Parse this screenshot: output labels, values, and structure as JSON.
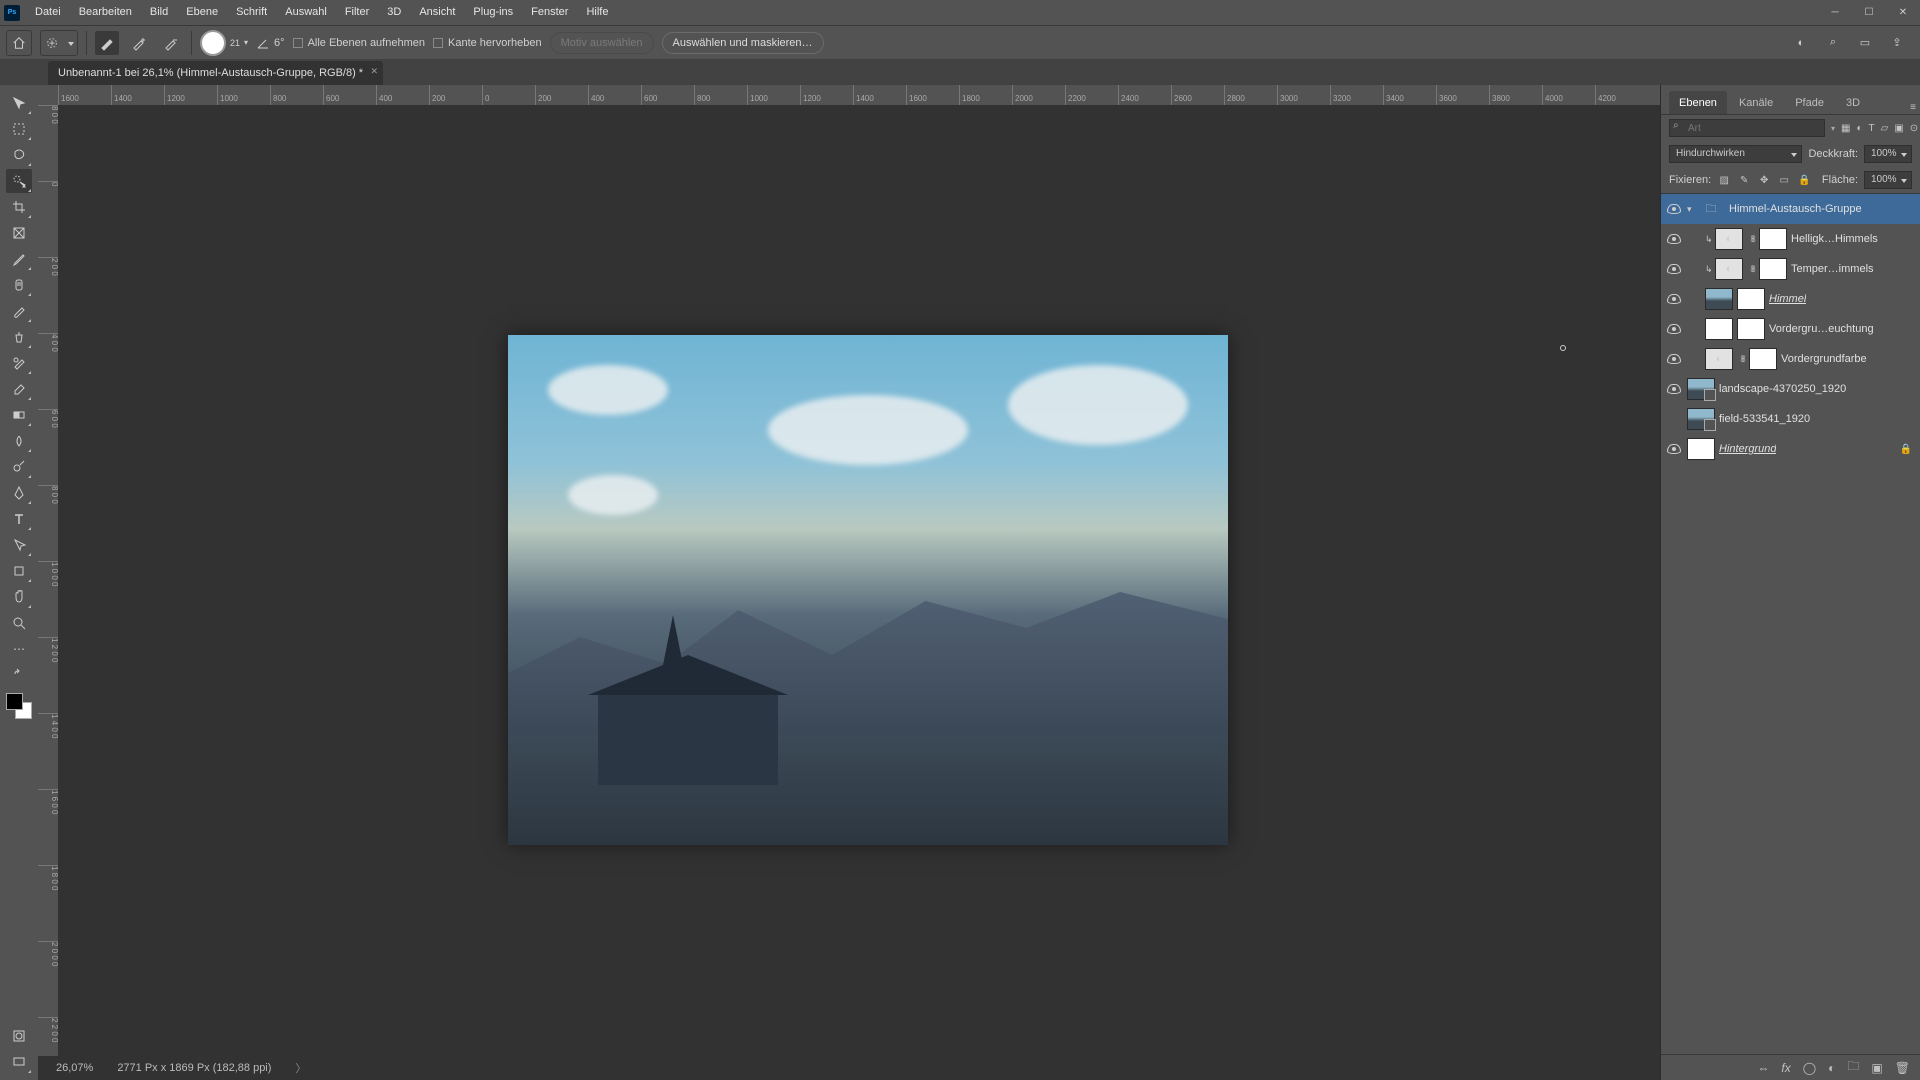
{
  "menubar": [
    "Datei",
    "Bearbeiten",
    "Bild",
    "Ebene",
    "Schrift",
    "Auswahl",
    "Filter",
    "3D",
    "Ansicht",
    "Plug-ins",
    "Fenster",
    "Hilfe"
  ],
  "optbar": {
    "brush_size": "21",
    "angle_label": "6°",
    "chk_all_layers": "Alle Ebenen aufnehmen",
    "chk_edge": "Kante hervorheben",
    "btn_subject_disabled": "Motiv auswählen",
    "btn_select_mask": "Auswählen und maskieren…"
  },
  "doc_tab": "Unbenannt-1 bei 26,1% (Himmel-Austausch-Gruppe, RGB/8) *",
  "ruler_h": [
    "1600",
    "1400",
    "1200",
    "1000",
    "800",
    "600",
    "400",
    "200",
    "0",
    "200",
    "400",
    "600",
    "800",
    "1000",
    "1200",
    "1400",
    "1600",
    "1800",
    "2000",
    "2200",
    "2400",
    "2600",
    "2800",
    "3000",
    "3200",
    "3400",
    "3600",
    "3800",
    "4000",
    "4200"
  ],
  "ruler_v": [
    "800",
    "0",
    "200",
    "400",
    "600",
    "800",
    "1000",
    "1200",
    "1400",
    "1600",
    "1800",
    "2000",
    "2200"
  ],
  "status": {
    "zoom": "26,07%",
    "docinfo": "2771 Px x 1869 Px (182,88 ppi)"
  },
  "rpanel": {
    "tabs": [
      "Ebenen",
      "Kanäle",
      "Pfade",
      "3D"
    ],
    "search": {
      "placeholder": "Art"
    },
    "blend": {
      "mode": "Hindurchwirken",
      "opacity_lbl": "Deckkraft:",
      "opacity": "100%"
    },
    "lock": {
      "label": "Fixieren:",
      "fill_lbl": "Fläche:",
      "fill": "100%"
    },
    "layers": [
      {
        "type": "group",
        "indent": 0,
        "name": "Himmel-Austausch-Gruppe",
        "selected": true,
        "open": true,
        "visible": true
      },
      {
        "type": "adj",
        "indent": 1,
        "name": "Helligk…Himmels",
        "clip": true,
        "link": true,
        "mask": true,
        "visible": true
      },
      {
        "type": "adj",
        "indent": 1,
        "name": "Temper…immels",
        "clip": true,
        "link": true,
        "mask": true,
        "visible": true
      },
      {
        "type": "img",
        "indent": 1,
        "name": "Himmel",
        "mask": true,
        "underline": true,
        "visible": true
      },
      {
        "type": "img",
        "indent": 1,
        "name": "Vordergru…euchtung",
        "mask": true,
        "visible": true,
        "whitethumb": true
      },
      {
        "type": "adj",
        "indent": 1,
        "name": "Vordergrundfarbe",
        "link": true,
        "mask": true,
        "visible": true
      },
      {
        "type": "so",
        "indent": 0,
        "name": "landscape-4370250_1920",
        "visible": true
      },
      {
        "type": "so",
        "indent": 0,
        "name": "field-533541_1920",
        "visible": false
      },
      {
        "type": "bg",
        "indent": 0,
        "name": "Hintergrund",
        "locked": true,
        "italic": true,
        "visible": true
      }
    ]
  }
}
